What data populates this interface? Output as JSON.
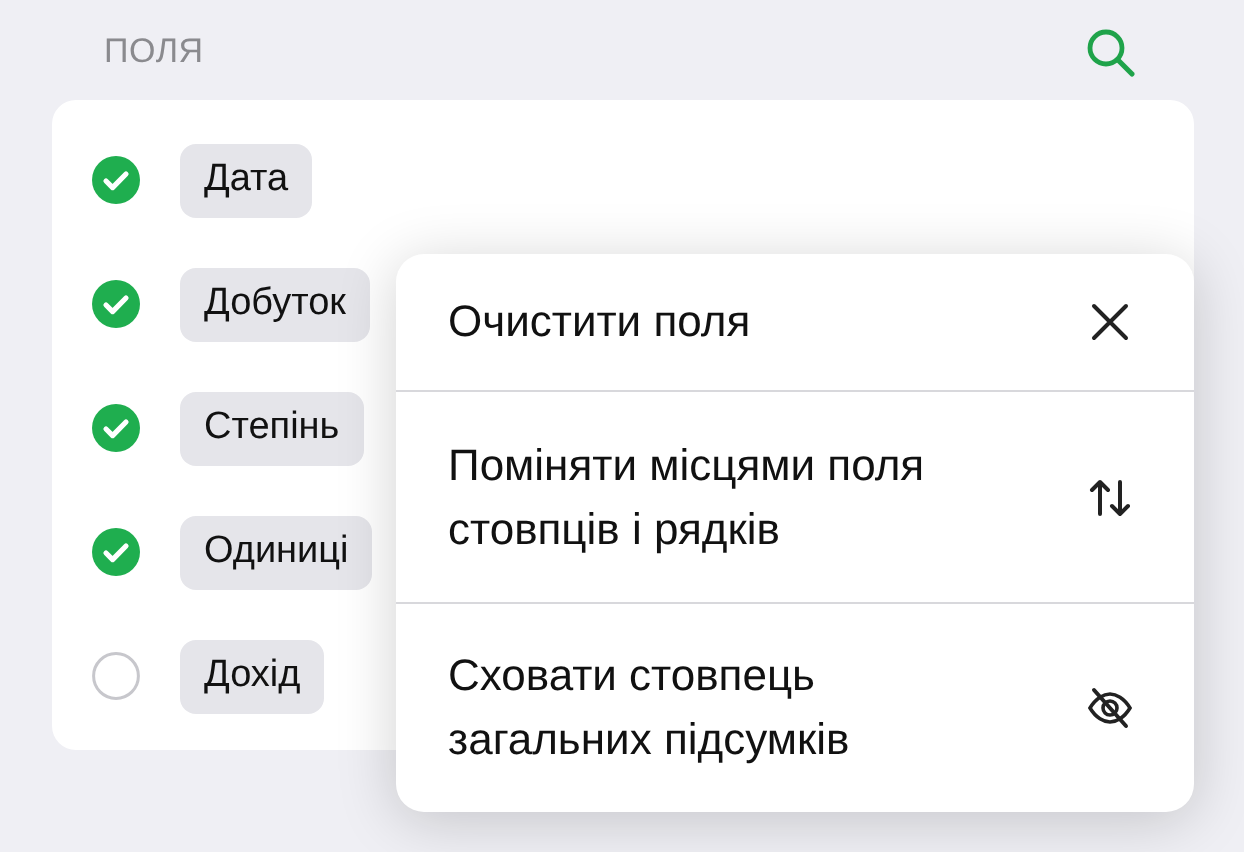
{
  "header": {
    "title": "ПОЛЯ"
  },
  "fields": [
    {
      "label": "Дата",
      "checked": true
    },
    {
      "label": "Добуток",
      "checked": true
    },
    {
      "label": "Степінь",
      "checked": true
    },
    {
      "label": "Одиниці",
      "checked": true
    },
    {
      "label": "Дохід",
      "checked": false
    }
  ],
  "menu": [
    {
      "label": "Очистити поля",
      "kind": "clear"
    },
    {
      "label": "Поміняти місцями поля стовпців і рядків",
      "kind": "swap"
    },
    {
      "label": "Сховати стовпець загальних підсумків",
      "kind": "hide"
    }
  ]
}
